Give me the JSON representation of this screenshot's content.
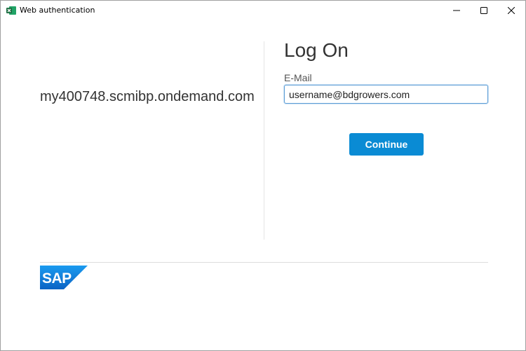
{
  "window": {
    "title": "Web authentication",
    "app_icon": "excel-icon",
    "controls": {
      "minimize": "minimize-icon",
      "maximize": "maximize-icon",
      "close": "close-icon"
    }
  },
  "left": {
    "host": "my400748.scmibp.ondemand.com"
  },
  "logon": {
    "title": "Log On",
    "email_label": "E-Mail",
    "email_value": "username@bdgrowers.com",
    "continue_label": "Continue"
  },
  "footer": {
    "logo_text": "SAP",
    "logo_color": "#0a6ed1"
  },
  "colors": {
    "accent": "#0a8bd4",
    "excel_green": "#1d6f42"
  }
}
